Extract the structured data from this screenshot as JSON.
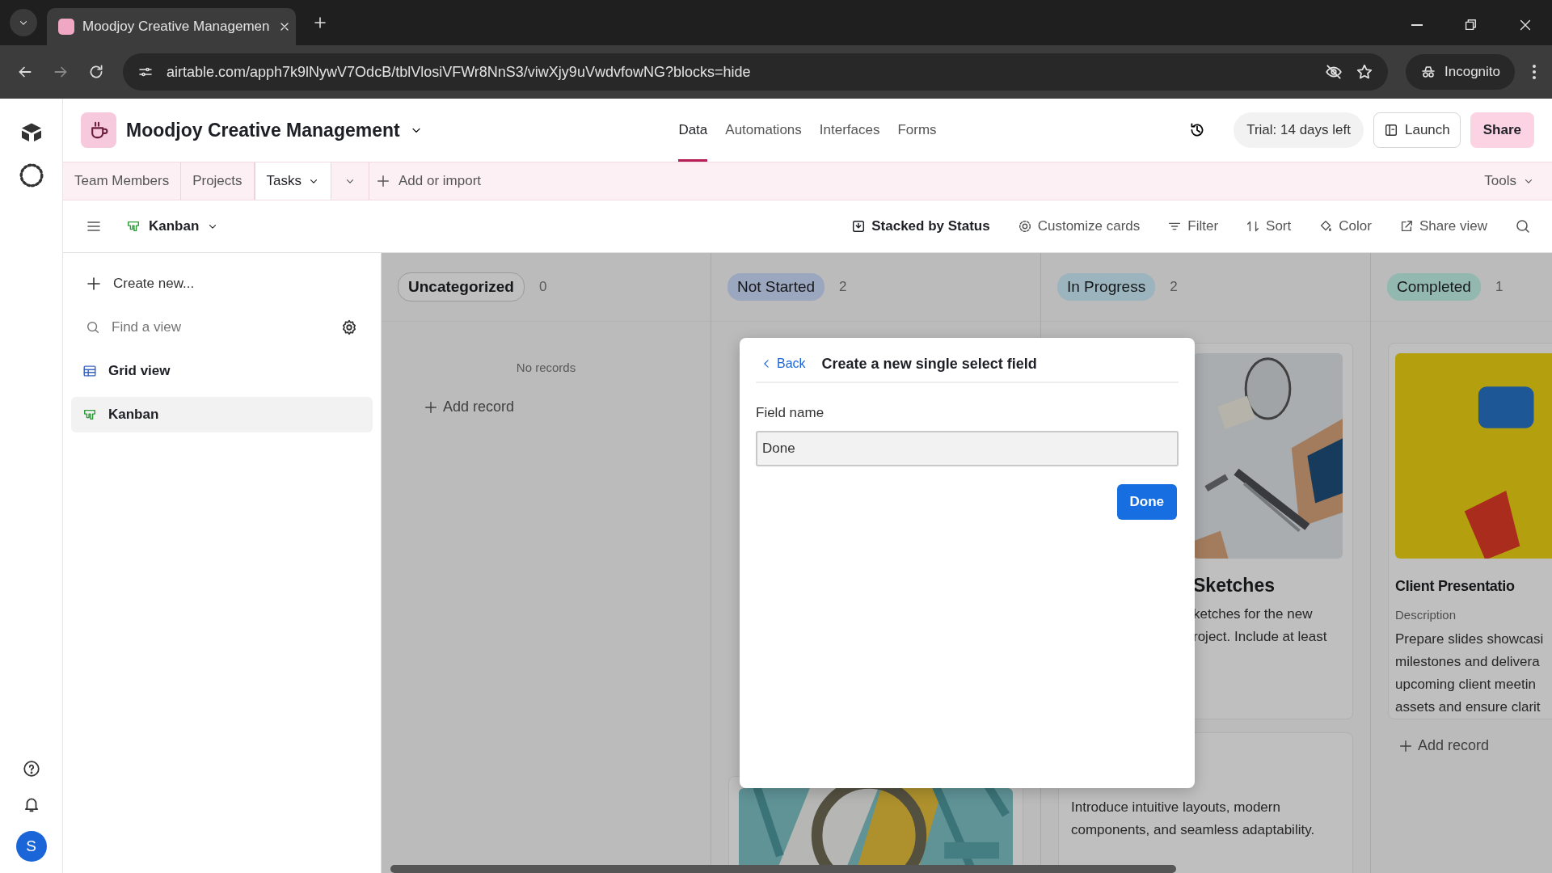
{
  "browser": {
    "tab_title": "Moodjoy Creative Managemen",
    "url": "airtable.com/apph7k9lNywV7OdcB/tblVlosiVFWr8NnS3/viwXjy9uVwdvfowNG?blocks=hide",
    "profile": "Incognito"
  },
  "header": {
    "base_name": "Moodjoy Creative Management",
    "trial": "Trial: 14 days left",
    "launch": "Launch",
    "share": "Share"
  },
  "nav_tabs": [
    {
      "label": "Data",
      "selected": true
    },
    {
      "label": "Automations",
      "selected": false
    },
    {
      "label": "Interfaces",
      "selected": false
    },
    {
      "label": "Forms",
      "selected": false
    }
  ],
  "tables": [
    {
      "label": "Team Members",
      "selected": false
    },
    {
      "label": "Projects",
      "selected": false
    },
    {
      "label": "Tasks",
      "selected": true
    }
  ],
  "add_or_import": "Add or import",
  "tools": "Tools",
  "view_bar": {
    "view_name": "Kanban",
    "actions": [
      "Stacked by Status",
      "Customize cards",
      "Filter",
      "Sort",
      "Color",
      "Share view"
    ]
  },
  "sidebar": {
    "create": "Create new...",
    "search_placeholder": "Find a view",
    "views": [
      {
        "label": "Grid view",
        "kind": "grid",
        "selected": false
      },
      {
        "label": "Kanban",
        "kind": "kanban",
        "selected": true
      }
    ]
  },
  "avatar": "S",
  "columns": [
    {
      "label": "Uncategorized",
      "count": "0",
      "color": "#bfbfbf",
      "empty_text": "No records",
      "add_record": "Add record"
    },
    {
      "label": "Not Started",
      "count": "2",
      "color": "#9ba7bf"
    },
    {
      "label": "In Progress",
      "count": "2",
      "color": "#9cb4be",
      "cards": [
        {
          "kind": "image_card",
          "title": "Sketches",
          "description_lines": [
            "ketches for the new",
            "roject. Include at least"
          ]
        },
        {
          "kind": "text_card",
          "description_lines": [
            "Introduce intuitive layouts, modern",
            "components, and seamless adaptability."
          ]
        }
      ]
    },
    {
      "label": "Completed",
      "count": "1",
      "color": "#92b8af",
      "add_record": "Add record",
      "cards": [
        {
          "kind": "image_card",
          "title": "Client Presentatio",
          "description_label": "Description",
          "description_lines": [
            "Prepare slides showcasi",
            "milestones and delivera",
            "upcoming client meetin",
            "assets and ensure clarit"
          ]
        }
      ]
    }
  ],
  "modal": {
    "back": "Back",
    "title": "Create a new single select field",
    "field_label": "Field name",
    "field_value": "Done",
    "button": "Done"
  }
}
